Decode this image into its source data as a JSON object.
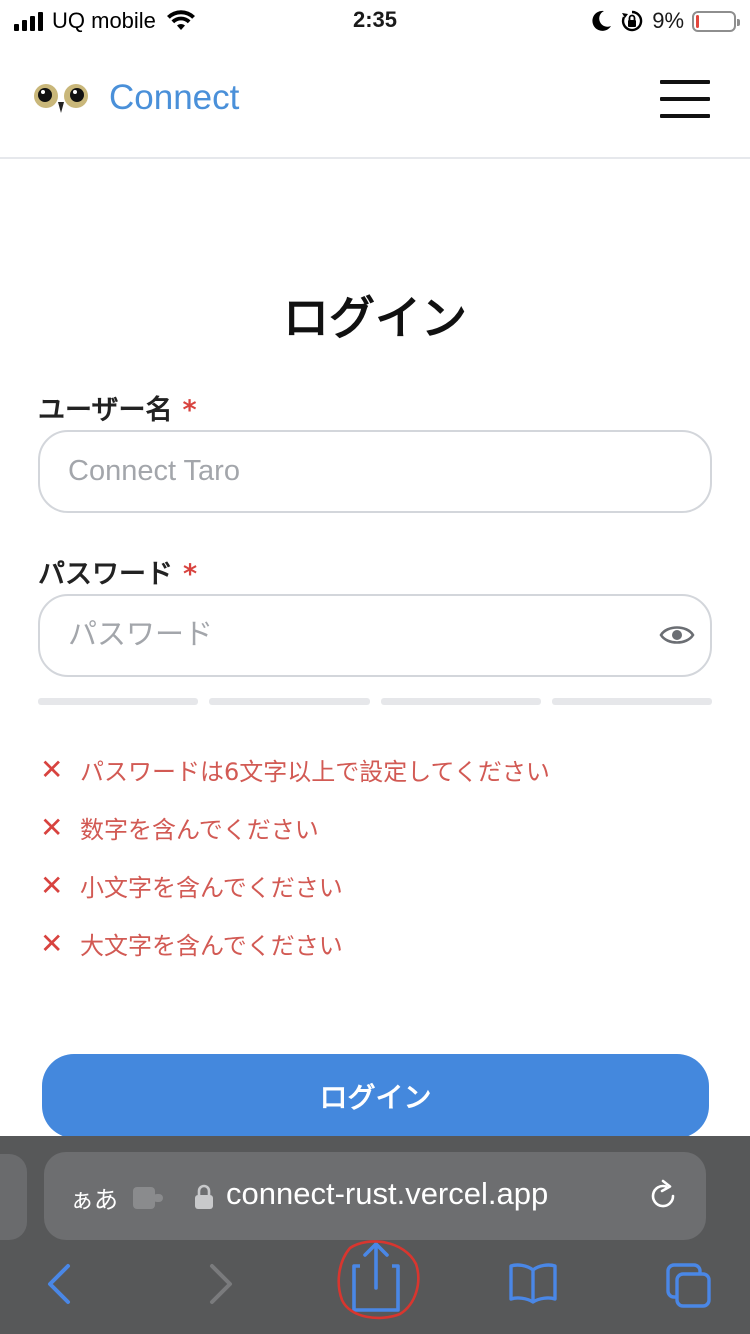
{
  "status_bar": {
    "carrier": "UQ mobile",
    "time": "2:35",
    "battery_percent": "9%",
    "icons": [
      "signal-icon",
      "wifi-icon",
      "moon-icon",
      "rotation-lock-icon",
      "battery-icon"
    ]
  },
  "header": {
    "brand": "Connect",
    "logo_icon": "owl-eyes-logo",
    "menu_icon": "hamburger-menu-icon"
  },
  "form": {
    "title": "ログイン",
    "username": {
      "label": "ユーザー名",
      "required_mark": "*",
      "placeholder": "Connect Taro",
      "value": ""
    },
    "password": {
      "label": "パスワード",
      "required_mark": "*",
      "placeholder": "パスワード",
      "value": "",
      "toggle_icon": "eye-icon",
      "strength_segments": 4,
      "strength_filled": 0
    },
    "rules": [
      {
        "icon": "cross-icon",
        "text": "パスワードは6文字以上で設定してください"
      },
      {
        "icon": "cross-icon",
        "text": "数字を含んでください"
      },
      {
        "icon": "cross-icon",
        "text": "小文字を含んでください"
      },
      {
        "icon": "cross-icon",
        "text": "大文字を含んでください"
      }
    ],
    "submit_label": "ログイン"
  },
  "browser": {
    "text_size_label": "ぁあ",
    "url": "connect-rust.vercel.app",
    "icons": [
      "extension-icon",
      "lock-icon",
      "reload-icon",
      "back-icon",
      "forward-icon",
      "share-icon",
      "bookmarks-icon",
      "tabs-icon"
    ]
  },
  "colors": {
    "brand": "#4a90d9",
    "primary_button": "#4488dd",
    "error": "#d8433f",
    "safari_ui_accent": "#4a87e6"
  }
}
